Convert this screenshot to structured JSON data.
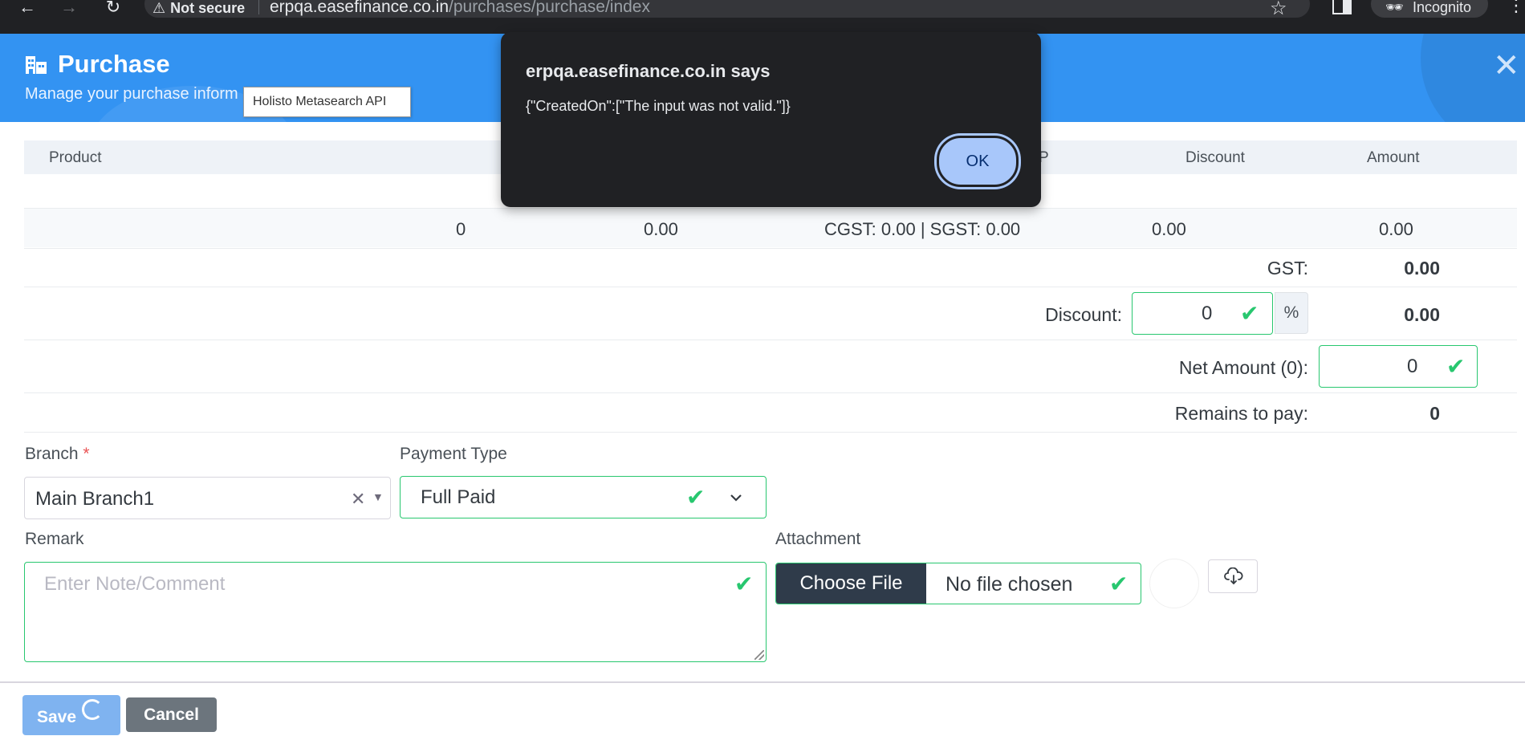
{
  "browser": {
    "security_label": "Not secure",
    "url_host": "erpqa.easefinance.co.in",
    "url_path": "/purchases/purchase/index",
    "profile_label": "Incognito"
  },
  "header": {
    "title": "Purchase",
    "subtitle": "Manage your purchase inform",
    "tooltip": "Holisto Metasearch API"
  },
  "grid": {
    "columns": [
      "Product",
      "P",
      "Discount",
      "Amount"
    ],
    "totals": {
      "qty": "0",
      "rate": "0.00",
      "tax": "CGST: 0.00 | SGST: 0.00",
      "discount": "0.00",
      "amount": "0.00"
    }
  },
  "summary": {
    "gst_label": "GST:",
    "gst_value": "0.00",
    "discount_label": "Discount:",
    "discount_input": "0",
    "discount_unit": "%",
    "discount_value": "0.00",
    "net_label": "Net Amount (0):",
    "net_input": "0",
    "remains_label": "Remains to pay:",
    "remains_value": "0"
  },
  "form": {
    "branch_label": "Branch",
    "required_mark": "*",
    "branch_value": "Main Branch1",
    "payment_label": "Payment Type",
    "payment_value": "Full Paid",
    "remark_label": "Remark",
    "remark_placeholder": "Enter Note/Comment",
    "attachment_label": "Attachment",
    "choose_file": "Choose File",
    "file_status": "No file chosen"
  },
  "footer": {
    "save_label": "Save",
    "cancel_label": "Cancel"
  },
  "dialog": {
    "title": "erpqa.easefinance.co.in says",
    "message": "{\"CreatedOn\":[\"The input was not valid.\"]}",
    "ok_label": "OK"
  },
  "colors": {
    "header_bg": "#3393f2",
    "valid_green": "#28c76f",
    "dialog_bg": "#202124",
    "ok_button": "#a8c7fa"
  }
}
